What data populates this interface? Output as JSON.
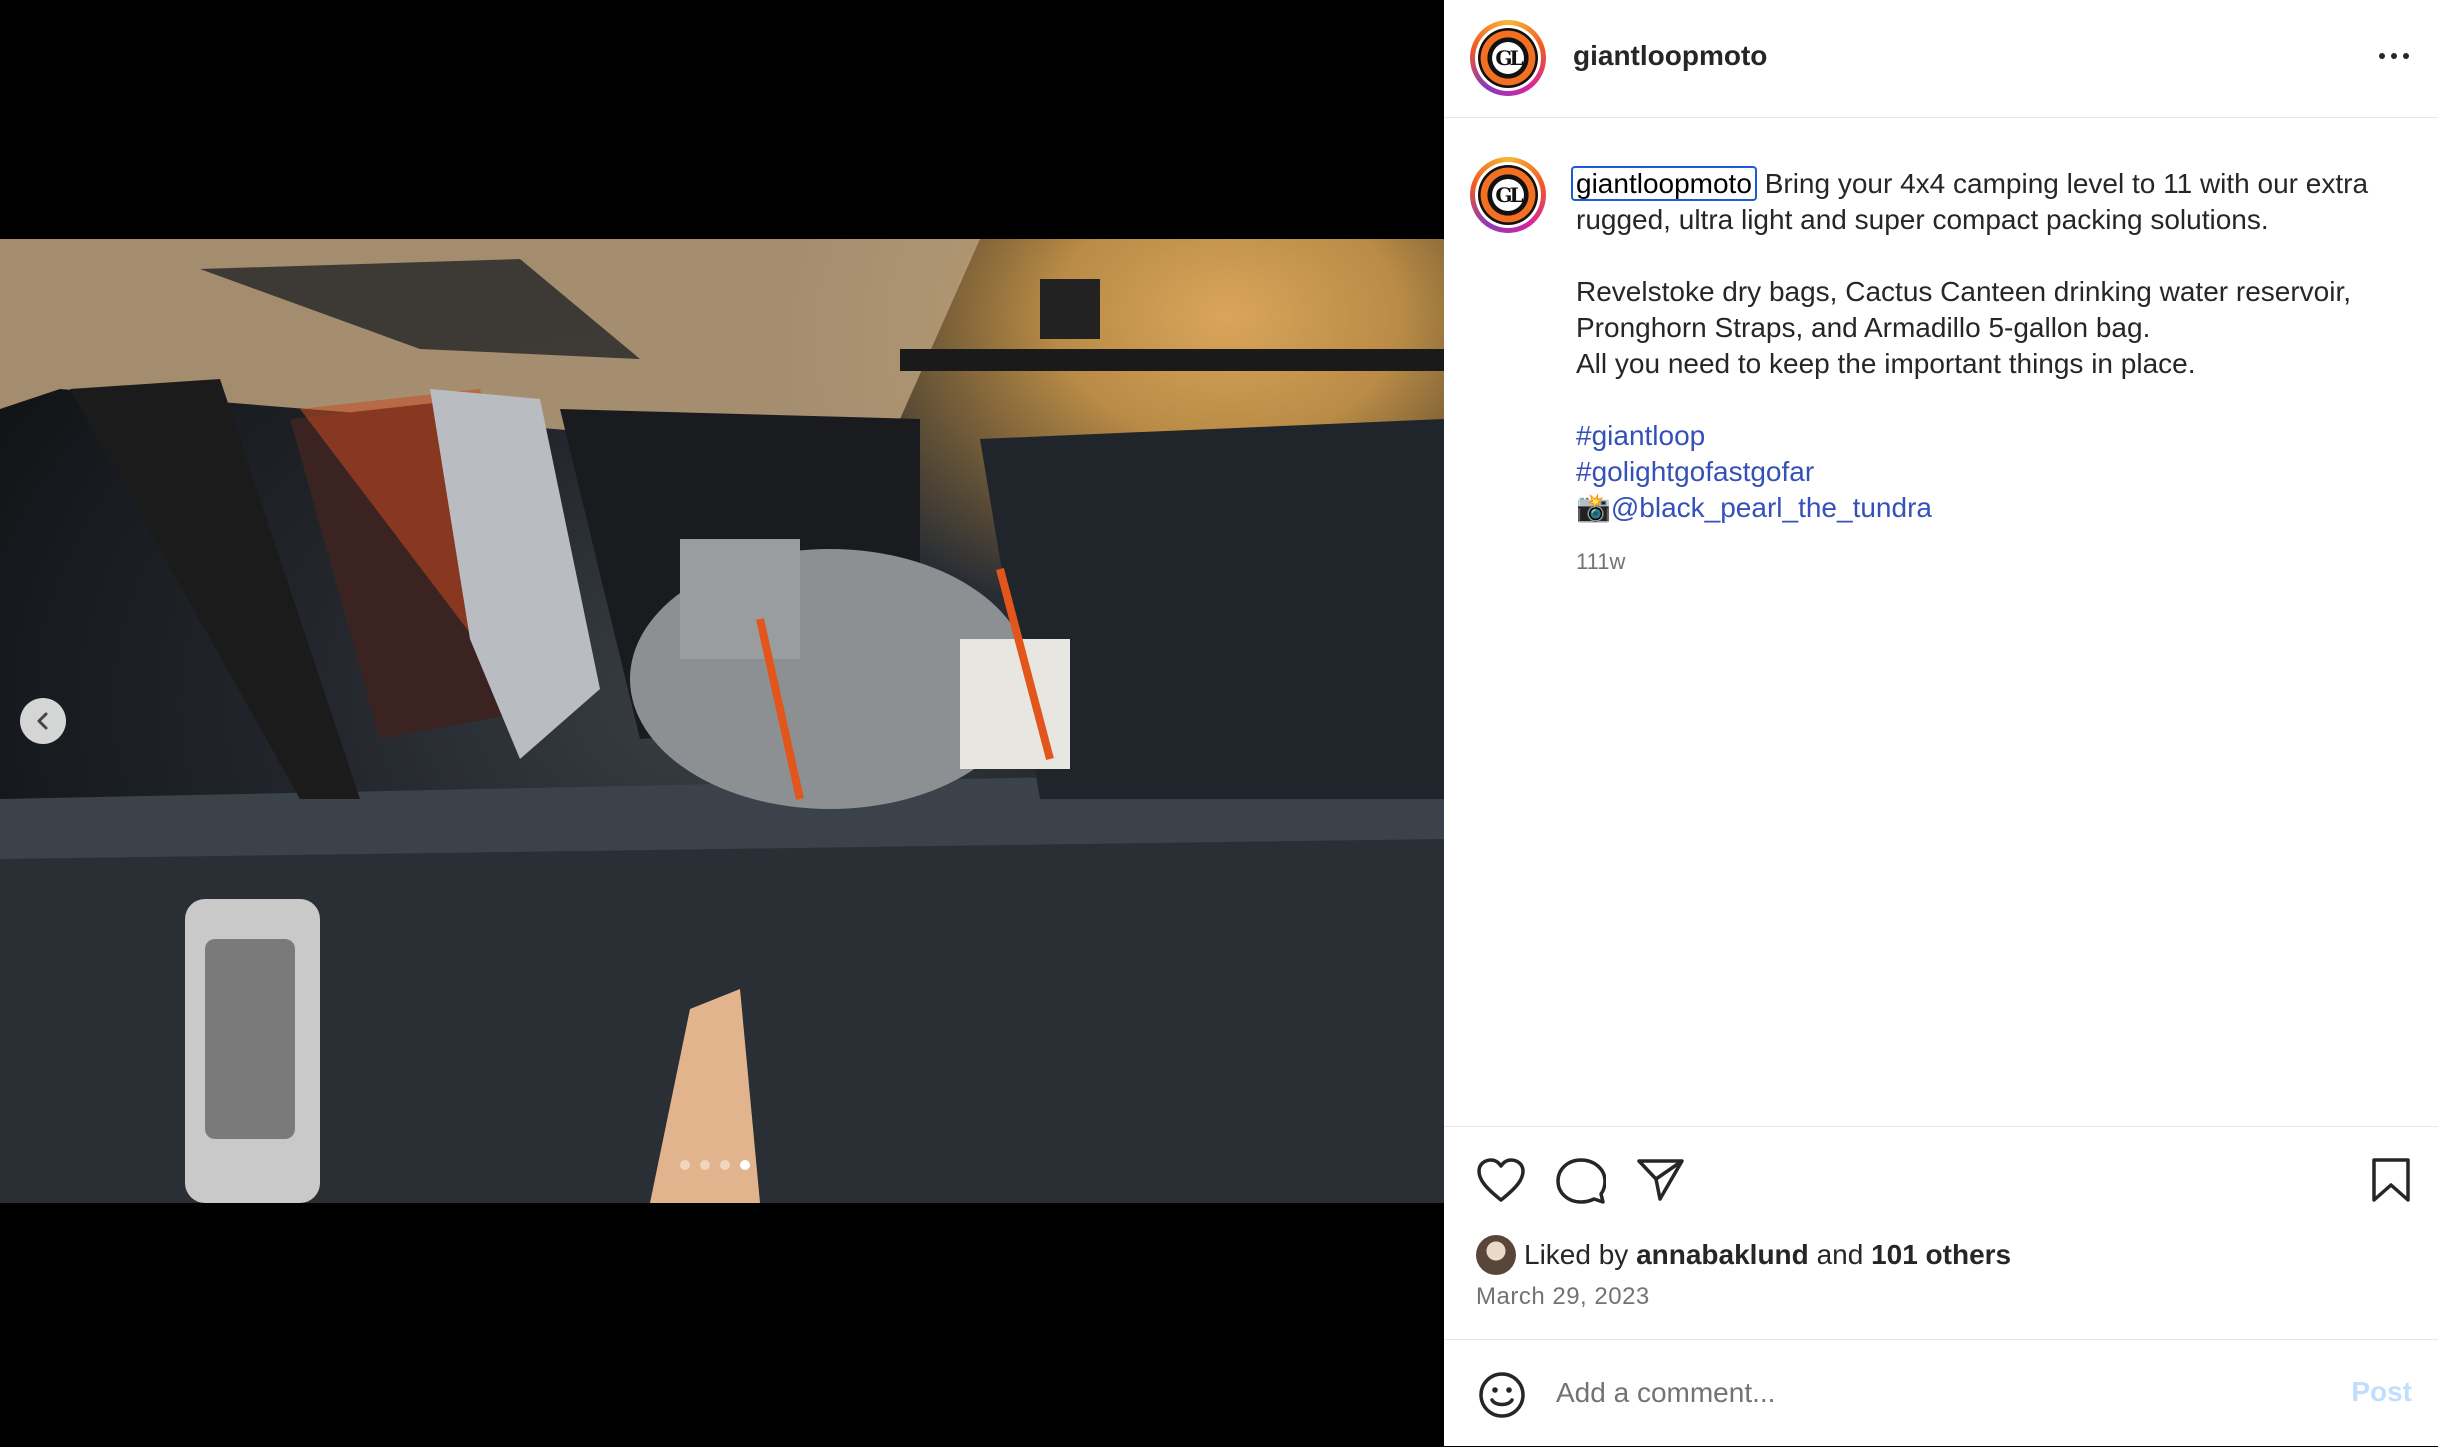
{
  "post": {
    "username": "giantloopmoto",
    "caption": {
      "user": "giantloopmoto",
      "line1": "Bring your 4x4 camping level to 11 with our extra",
      "line2": "rugged, ultra light and super compact packing solutions.",
      "line3": "Revelstoke dry bags, Cactus Canteen drinking water reservoir,",
      "line4": "Pronghorn Straps, and Armadillo 5-gallon bag.",
      "line5": "All you need to keep the important things in place.",
      "hashtag1": "#giantloop",
      "hashtag2": "#golightgofastgofar",
      "camera_emoji": "📸",
      "mention": "@black_pearl_the_tundra",
      "age": "111w"
    },
    "likes": {
      "prefix": "Liked by",
      "user": "annabaklund",
      "and": "and",
      "others": "101 others"
    },
    "date": "March 29, 2023"
  },
  "logo_text": "GL",
  "comment": {
    "placeholder": "Add a comment...",
    "post_label": "Post"
  },
  "carousel": {
    "slides": 4,
    "active": 4
  },
  "icons": [
    "more-icon",
    "chevron-left-icon",
    "heart-icon",
    "comment-icon",
    "share-icon",
    "bookmark-icon",
    "emoji-icon"
  ],
  "colors": {
    "link": "#3550b8",
    "post_disabled": "#c0dffd",
    "muted": "#737373"
  }
}
